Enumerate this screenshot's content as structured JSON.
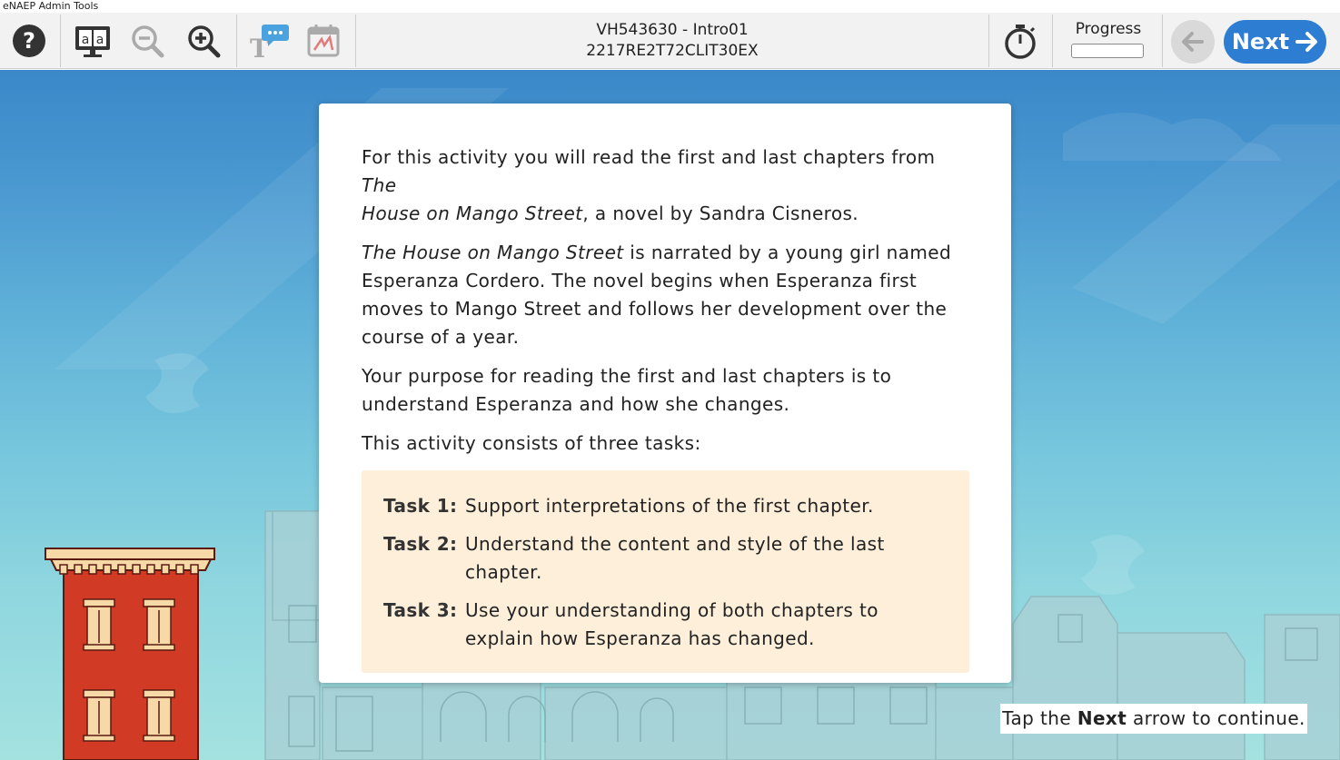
{
  "window": {
    "title": "eNAEP Admin Tools"
  },
  "toolbar": {
    "title_line1": "VH543630 - Intro01",
    "title_line2": "2217RE2T72CLIT30EX",
    "progress_label": "Progress",
    "progress_value": 0,
    "next_label": "Next",
    "icons": [
      "help-icon",
      "read-aloud-icon",
      "zoom-out-icon",
      "zoom-in-icon",
      "text-help-icon",
      "scratchwork-icon",
      "timer-icon",
      "back-arrow-icon",
      "next-arrow-icon"
    ]
  },
  "colors": {
    "accent": "#2d7dd2",
    "task_box": "#fdefd9",
    "building_red": "#d13b25"
  },
  "intro": {
    "p1_pre": "For this activity you will read the first and last chapters from ",
    "p1_title_a": "The",
    "p1_title_b": "House on Mango Street",
    "p1_post": ", a novel by Sandra Cisneros.",
    "p2_title": "The House on Mango Street",
    "p2_rest": " is narrated by a young girl named Esperanza Cordero. The novel begins when Esperanza first moves to Mango Street and follows her development over the course of a year.",
    "p3": "Your purpose for reading the first and last chapters is to understand Esperanza and how she changes.",
    "p4": "This activity consists of three tasks:"
  },
  "tasks": [
    {
      "label": "Task 1:",
      "text": "Support interpretations of the first chapter."
    },
    {
      "label": "Task 2:",
      "text": "Understand the content and style of the last chapter."
    },
    {
      "label": "Task 3:",
      "text": "Use your understanding of both chapters to explain how Esperanza has changed."
    }
  ],
  "hint": {
    "pre": "Tap the ",
    "bold": "Next",
    "post": " arrow to continue."
  }
}
